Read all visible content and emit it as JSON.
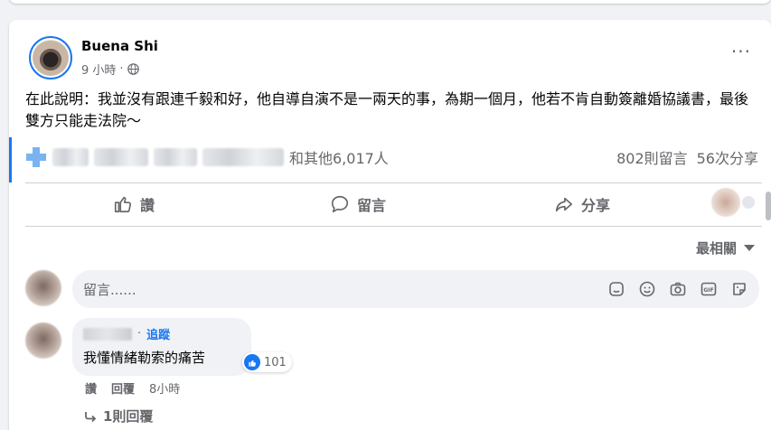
{
  "post": {
    "author": "Buena Shi",
    "time": "9 小時",
    "separator": "·",
    "text": "在此說明：我並沒有跟連千毅和好，他自導自演不是一兩天的事，為期一個月，他若不肯自動簽離婚協議書，最後雙方只能走法院～",
    "reactions_suffix": "和其他6,017人",
    "comments_count": "802則留言",
    "shares_count": "56次分享"
  },
  "actions": {
    "like": "讚",
    "comment": "留言",
    "share": "分享"
  },
  "sort": {
    "label": "最相關"
  },
  "comment_input": {
    "placeholder": "留言......"
  },
  "comment": {
    "follow": "追蹤",
    "text": "我懂情緒勒索的痛苦",
    "like_count": "101",
    "like_label": "讚",
    "reply_label": "回覆",
    "time": "8小時",
    "view_replies": "1則回覆"
  },
  "colors": {
    "accent": "#1877f2",
    "secondary_text": "#65676b",
    "background": "#f0f2f5"
  },
  "icons": [
    "globe-icon",
    "more-icon",
    "like-icon",
    "comment-icon",
    "share-icon",
    "sticker-icon",
    "emoji-icon",
    "camera-icon",
    "gif-icon",
    "avatar-sticker-icon",
    "reply-arrow-icon",
    "sort-caret-icon"
  ]
}
